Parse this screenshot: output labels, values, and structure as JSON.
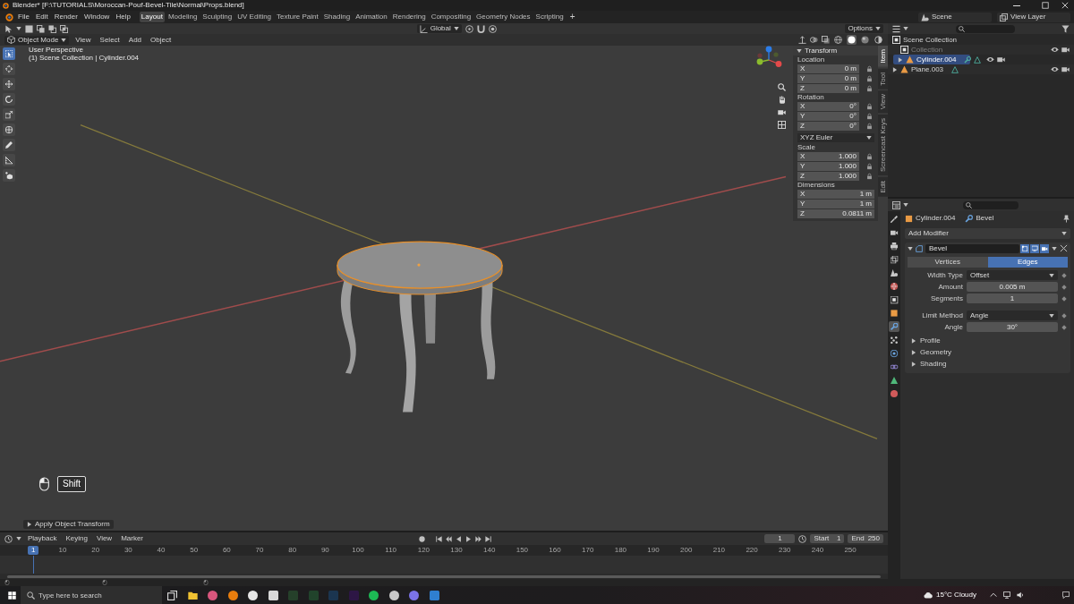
{
  "window": {
    "title": "Blender* [F:\\TUTORIALS\\Moroccan-Pouf-Bevel-Tile\\Normal\\Props.blend]"
  },
  "topbar": {
    "menus": [
      "File",
      "Edit",
      "Render",
      "Window",
      "Help"
    ],
    "workspaces": [
      {
        "label": "Layout",
        "selected": true
      },
      {
        "label": "Modeling",
        "selected": false
      },
      {
        "label": "Sculpting",
        "selected": false
      },
      {
        "label": "UV Editing",
        "selected": false
      },
      {
        "label": "Texture Paint",
        "selected": false
      },
      {
        "label": "Shading",
        "selected": false
      },
      {
        "label": "Animation",
        "selected": false
      },
      {
        "label": "Rendering",
        "selected": false
      },
      {
        "label": "Compositing",
        "selected": false
      },
      {
        "label": "Geometry Nodes",
        "selected": false
      },
      {
        "label": "Scripting",
        "selected": false
      }
    ],
    "add_workspace": "+",
    "scene": "Scene",
    "view_layer": "View Layer"
  },
  "viewport": {
    "orientation": "Global",
    "options": "Options",
    "mode": "Object Mode",
    "menus": [
      "View",
      "Select",
      "Add",
      "Object"
    ],
    "shading": [
      {
        "kind": "wireframe",
        "selected": false
      },
      {
        "kind": "solid",
        "selected": true
      },
      {
        "kind": "material",
        "selected": false
      },
      {
        "kind": "rendered",
        "selected": false
      }
    ],
    "tools": [
      {
        "kind": "select",
        "selected": true
      },
      {
        "kind": "cursor",
        "selected": false
      },
      {
        "kind": "move",
        "selected": false
      },
      {
        "kind": "rotate",
        "selected": false
      },
      {
        "kind": "scale",
        "selected": false
      },
      {
        "kind": "transform",
        "selected": false
      },
      {
        "kind": "annotate",
        "selected": false
      },
      {
        "kind": "measure",
        "selected": false
      },
      {
        "kind": "add_cube",
        "selected": false
      }
    ],
    "info": [
      "User Perspective",
      "(1) Scene Collection | Cylinder.004"
    ],
    "key_hint": "Shift",
    "last_operator": "Apply Object Transform"
  },
  "sidebar": {
    "tabs": [
      {
        "label": "Item",
        "selected": true
      },
      {
        "label": "Tool",
        "selected": false
      },
      {
        "label": "View",
        "selected": false
      },
      {
        "label": "Screencast Keys",
        "selected": false
      },
      {
        "label": "Edit",
        "selected": false
      }
    ],
    "title": "Transform",
    "rows": [
      {
        "kind": "vector",
        "label": "Location",
        "locks": true,
        "fields": [
          {
            "axis": "X",
            "value": "0 m"
          },
          {
            "axis": "Y",
            "value": "0 m"
          },
          {
            "axis": "Z",
            "value": "0 m"
          }
        ]
      },
      {
        "kind": "vector",
        "label": "Rotation",
        "locks": true,
        "fields": [
          {
            "axis": "X",
            "value": "0°"
          },
          {
            "axis": "Y",
            "value": "0°"
          },
          {
            "axis": "Z",
            "value": "0°"
          }
        ]
      },
      {
        "kind": "dropdown",
        "value": "XYZ Euler"
      },
      {
        "kind": "vector",
        "label": "Scale",
        "locks": true,
        "fields": [
          {
            "axis": "X",
            "value": "1.000"
          },
          {
            "axis": "Y",
            "value": "1.000"
          },
          {
            "axis": "Z",
            "value": "1.000"
          }
        ]
      },
      {
        "kind": "vector",
        "label": "Dimensions",
        "locks": false,
        "fields": [
          {
            "axis": "X",
            "value": "1 m"
          },
          {
            "axis": "Y",
            "value": "1 m"
          },
          {
            "axis": "Z",
            "value": "0.0811 m"
          }
        ]
      }
    ]
  },
  "outliner": {
    "items": [
      {
        "kind": "collection",
        "label": "Scene Collection",
        "children": [
          {
            "kind": "collection",
            "label": "Collection",
            "selected": false,
            "dimmed": true
          },
          {
            "kind": "object",
            "label": "Cylinder.004",
            "selected": true,
            "dimmed": false,
            "badges": [
              {
                "kind": "modifier"
              },
              {
                "kind": "mesh"
              }
            ]
          },
          {
            "kind": "object",
            "label": "Plane.003",
            "selected": false,
            "dimmed": false,
            "badges": [
              {
                "kind": "mesh"
              }
            ]
          }
        ]
      }
    ]
  },
  "properties": {
    "tabs": [
      {
        "kind": "tool",
        "selected": false
      },
      {
        "kind": "render",
        "selected": false
      },
      {
        "kind": "output",
        "selected": false
      },
      {
        "kind": "view_layer",
        "selected": false
      },
      {
        "kind": "scene",
        "selected": false
      },
      {
        "kind": "world",
        "selected": false
      },
      {
        "kind": "collection",
        "selected": false
      },
      {
        "kind": "object",
        "selected": false
      },
      {
        "kind": "modifiers",
        "selected": true
      },
      {
        "kind": "particles",
        "selected": false
      },
      {
        "kind": "physics",
        "selected": false
      },
      {
        "kind": "constraints",
        "selected": false
      },
      {
        "kind": "data",
        "selected": false
      },
      {
        "kind": "material",
        "selected": false
      }
    ],
    "context": [
      {
        "kind": "object",
        "label": "Cylinder.004"
      },
      {
        "kind": "modifier",
        "label": "Bevel"
      }
    ],
    "add_modifier": "Add Modifier",
    "modifier": {
      "name": "Bevel",
      "expanded": true,
      "toggles": [
        {
          "kind": "edit_mode",
          "on": true
        },
        {
          "kind": "viewport",
          "on": true
        },
        {
          "kind": "render",
          "on": true
        }
      ],
      "affect": [
        {
          "label": "Vertices",
          "selected": false
        },
        {
          "label": "Edges",
          "selected": true
        }
      ],
      "field_groups": [
        [
          {
            "kind": "dropdown",
            "label": "Width Type",
            "value": "Offset"
          },
          {
            "kind": "number",
            "label": "Amount",
            "value": "0.005 m"
          },
          {
            "kind": "number",
            "label": "Segments",
            "value": "1"
          }
        ],
        [
          {
            "kind": "dropdown",
            "label": "Limit Method",
            "value": "Angle"
          },
          {
            "kind": "number",
            "label": "Angle",
            "value": "30°"
          }
        ]
      ],
      "subpanels": [
        {
          "label": "Profile",
          "expanded": false
        },
        {
          "label": "Geometry",
          "expanded": false
        },
        {
          "label": "Shading",
          "expanded": false
        }
      ]
    }
  },
  "timeline": {
    "menus": [
      "Playback",
      "Keying",
      "View",
      "Marker"
    ],
    "current_frame": "1",
    "start_label": "Start",
    "start": "1",
    "end_label": "End",
    "end": "250",
    "playhead": "1",
    "ticks": [
      "10",
      "20",
      "30",
      "40",
      "50",
      "60",
      "70",
      "80",
      "90",
      "100",
      "110",
      "120",
      "130",
      "140",
      "150",
      "160",
      "170",
      "180",
      "190",
      "200",
      "210",
      "220",
      "230",
      "240",
      "250"
    ]
  },
  "taskbar": {
    "search_placeholder": "Type here to search",
    "apps": [
      {
        "kind": "task_view"
      },
      {
        "kind": "folder"
      },
      {
        "kind": "disc",
        "color": "#d9567d"
      },
      {
        "kind": "disc",
        "color": "#e87d0d"
      },
      {
        "kind": "disc",
        "color": "#e6e6e6"
      },
      {
        "kind": "tile",
        "color": "#d8d8d8"
      },
      {
        "kind": "tile",
        "color": "#25402a"
      },
      {
        "kind": "tile",
        "color": "#21432b"
      },
      {
        "kind": "tile",
        "color": "#1b3550"
      },
      {
        "kind": "tile",
        "color": "#2d1645"
      },
      {
        "kind": "disc",
        "color": "#1db954"
      },
      {
        "kind": "disc",
        "color": "#c8c8c8"
      },
      {
        "kind": "disc",
        "color": "#7b73e8"
      },
      {
        "kind": "tile",
        "color": "#2f7fd0"
      }
    ],
    "weather": "15°C Cloudy"
  }
}
